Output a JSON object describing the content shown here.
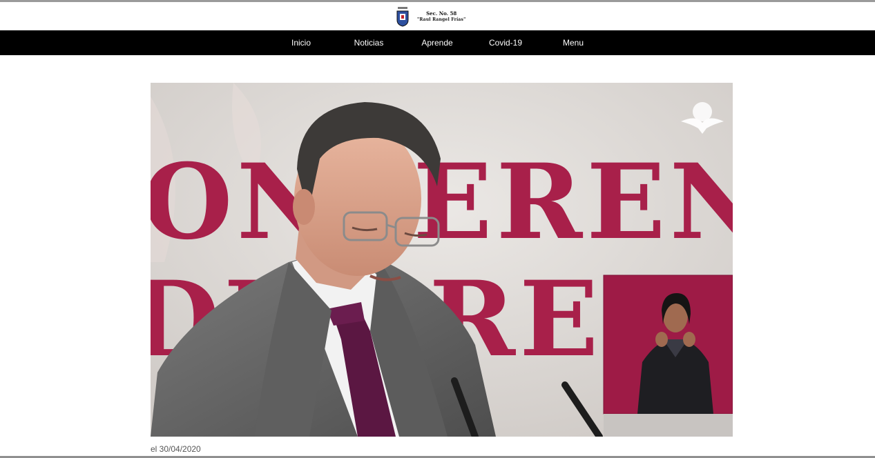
{
  "header": {
    "logo_line1": "Sec. No. 58",
    "logo_line2": "\"Raul Rangel Frías\"",
    "logo_icon": "school-seal-icon"
  },
  "nav": {
    "items": [
      {
        "label": "Inicio"
      },
      {
        "label": "Noticias"
      },
      {
        "label": "Aprende"
      },
      {
        "label": "Covid-19"
      },
      {
        "label": "Menu"
      }
    ]
  },
  "video": {
    "backdrop_text_top": "ONFERENCIA",
    "backdrop_text_bottom": "DE PRENSA",
    "watermark_icon": "government-emblem-icon",
    "inset": "sign-language-interpreter",
    "colors": {
      "backdrop": "#d9d5d2",
      "accent": "#a8204a",
      "inset_bg": "#9e1b46"
    }
  },
  "post": {
    "date": "el 30/04/2020"
  }
}
